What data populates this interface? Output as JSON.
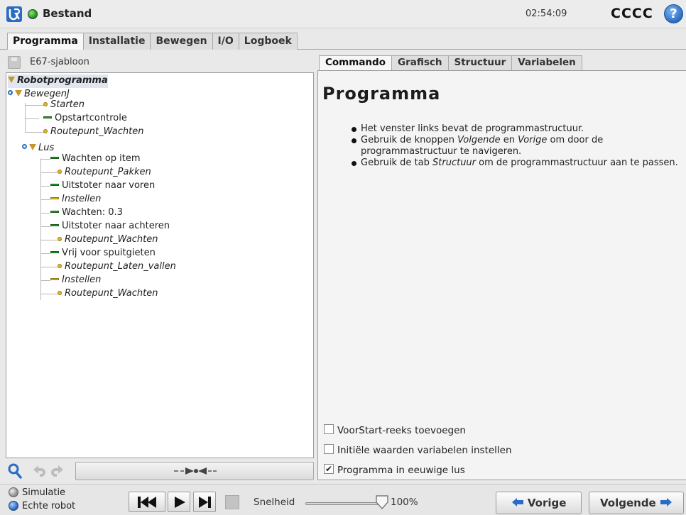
{
  "header": {
    "app_title": "Bestand",
    "clock": "02:54:09",
    "robot_name": "CCCC",
    "help_glyph": "?"
  },
  "main_tabs": [
    {
      "label": "Programma",
      "active": true
    },
    {
      "label": "Installatie",
      "active": false
    },
    {
      "label": "Bewegen",
      "active": false
    },
    {
      "label": "I/O",
      "active": false
    },
    {
      "label": "Logboek",
      "active": false
    }
  ],
  "left": {
    "file_name": "E67-sjabloon",
    "tree": [
      {
        "label": "Robotprogramma",
        "marker": "triangle",
        "style": "bold-italic",
        "level": 0
      },
      {
        "label": "BewegenJ",
        "marker": "triangle",
        "style": "italic",
        "level": 1
      },
      {
        "label": "Starten",
        "marker": "dot",
        "style": "italic",
        "level": 2
      },
      {
        "label": "Opstartcontrole",
        "marker": "green",
        "style": "normal",
        "level": 2
      },
      {
        "label": "Routepunt_Wachten",
        "marker": "dot",
        "style": "italic",
        "level": 2
      },
      {
        "label": "Lus",
        "marker": "triangle",
        "style": "italic",
        "level": 2
      },
      {
        "label": "Wachten op item",
        "marker": "green",
        "style": "normal",
        "level": 3
      },
      {
        "label": "Routepunt_Pakken",
        "marker": "dot",
        "style": "italic",
        "level": 3
      },
      {
        "label": "Uitstoter naar voren",
        "marker": "green",
        "style": "normal",
        "level": 3
      },
      {
        "label": "Instellen",
        "marker": "yellow",
        "style": "italic",
        "level": 3
      },
      {
        "label": "Wachten: 0.3",
        "marker": "green",
        "style": "normal",
        "level": 3
      },
      {
        "label": "Uitstoter naar achteren",
        "marker": "green",
        "style": "normal",
        "level": 3
      },
      {
        "label": "Routepunt_Wachten",
        "marker": "dot",
        "style": "italic",
        "level": 3
      },
      {
        "label": "Vrij voor spuitgieten",
        "marker": "green",
        "style": "normal",
        "level": 3
      },
      {
        "label": "Routepunt_Laten_vallen",
        "marker": "dot",
        "style": "italic",
        "level": 3
      },
      {
        "label": "Instellen",
        "marker": "yellow",
        "style": "italic",
        "level": 3
      },
      {
        "label": "Routepunt_Wachten",
        "marker": "dot",
        "style": "italic",
        "level": 3
      }
    ]
  },
  "sub_tabs": [
    {
      "label": "Commando",
      "active": true
    },
    {
      "label": "Grafisch",
      "active": false
    },
    {
      "label": "Structuur",
      "active": false
    },
    {
      "label": "Variabelen",
      "active": false
    }
  ],
  "right": {
    "title": "Programma",
    "info": {
      "line1": "Het venster links bevat de programmastructuur.",
      "line2_pre": "Gebruik de knoppen ",
      "line2_volgende": "Volgende",
      "line2_mid": " en ",
      "line2_vorige": "Vorige",
      "line2_post": " om door de programmastructuur te navigeren.",
      "line3_pre": "Gebruik de tab ",
      "line3_structuur": "Structuur",
      "line3_post": " om de programmastructuur aan te passen."
    },
    "checkboxes": [
      {
        "label": "VoorStart-reeks toevoegen",
        "checked": false
      },
      {
        "label": "Initiële waarden variabelen instellen",
        "checked": false
      },
      {
        "label": "Programma in eeuwige lus",
        "checked": true
      }
    ]
  },
  "bottom": {
    "mode_simulation": "Simulatie",
    "mode_real": "Echte robot",
    "speed_label": "Snelheid",
    "speed_value": "100%",
    "speed_fraction": 1.0,
    "prev_label": "Vorige",
    "next_label": "Volgende"
  },
  "icons": {
    "logo": "ur-logo-icon",
    "status": "status-ok-icon",
    "help": "help-icon",
    "search": "search-icon",
    "undo": "undo-icon",
    "redo": "redo-icon"
  },
  "colors": {
    "status_ok": "#2f9b18",
    "tree_triangle": "#c8952c",
    "command_green": "#2b9b2b",
    "set_yellow": "#e0c12a",
    "help_blue": "#2a6cc4"
  }
}
